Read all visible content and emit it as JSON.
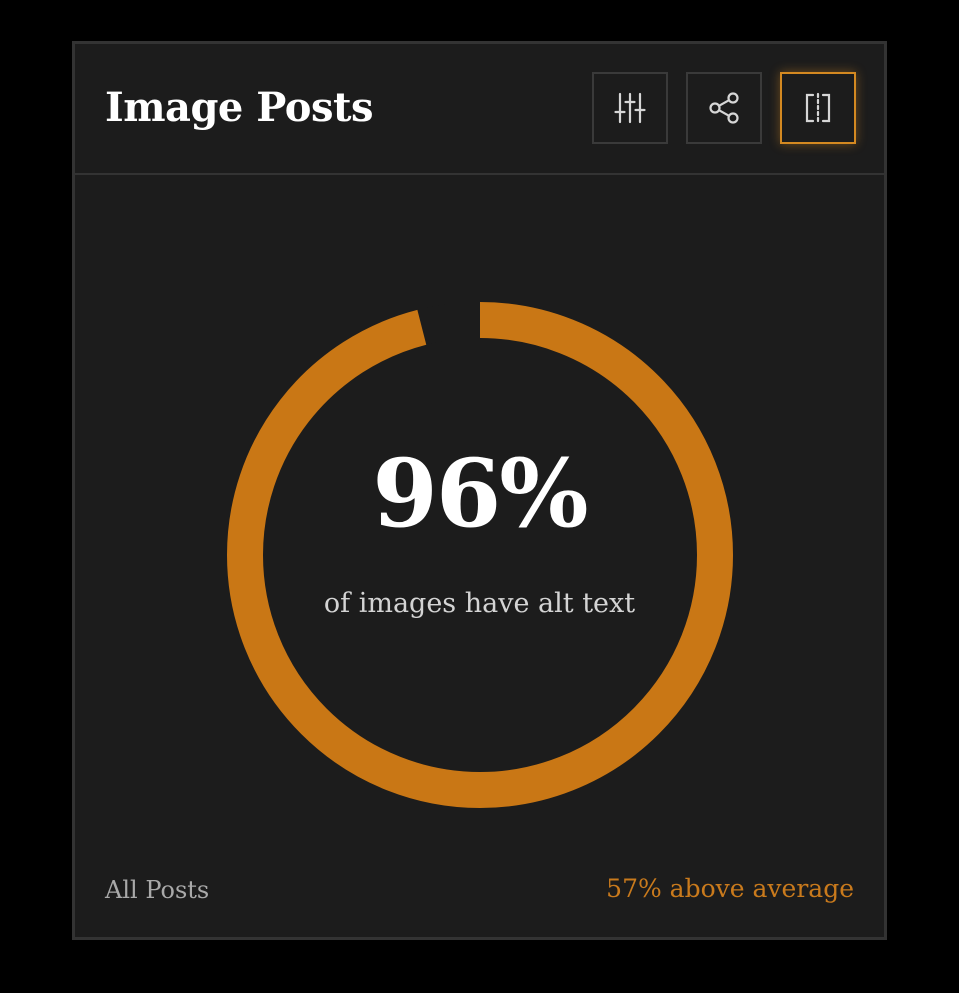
{
  "card": {
    "title": "Image Posts",
    "toolbar": [
      {
        "icon": "sliders-icon",
        "label": "Filter"
      },
      {
        "icon": "share-icon",
        "label": "Share"
      },
      {
        "icon": "split-view-icon",
        "label": "Split view",
        "active": true
      }
    ]
  },
  "chart_data": {
    "type": "pie",
    "variant": "donut",
    "values": [
      96,
      4
    ],
    "value_label": "96%",
    "caption": "of images have alt text",
    "colors": {
      "filled": "#c97715",
      "remainder": "#1c1c1c"
    }
  },
  "footer": {
    "scope": "All Posts",
    "comparison": "57% above average"
  },
  "colors": {
    "accent": "#c97715",
    "background": "#1c1c1c",
    "page": "#000000",
    "border": "#333333"
  }
}
